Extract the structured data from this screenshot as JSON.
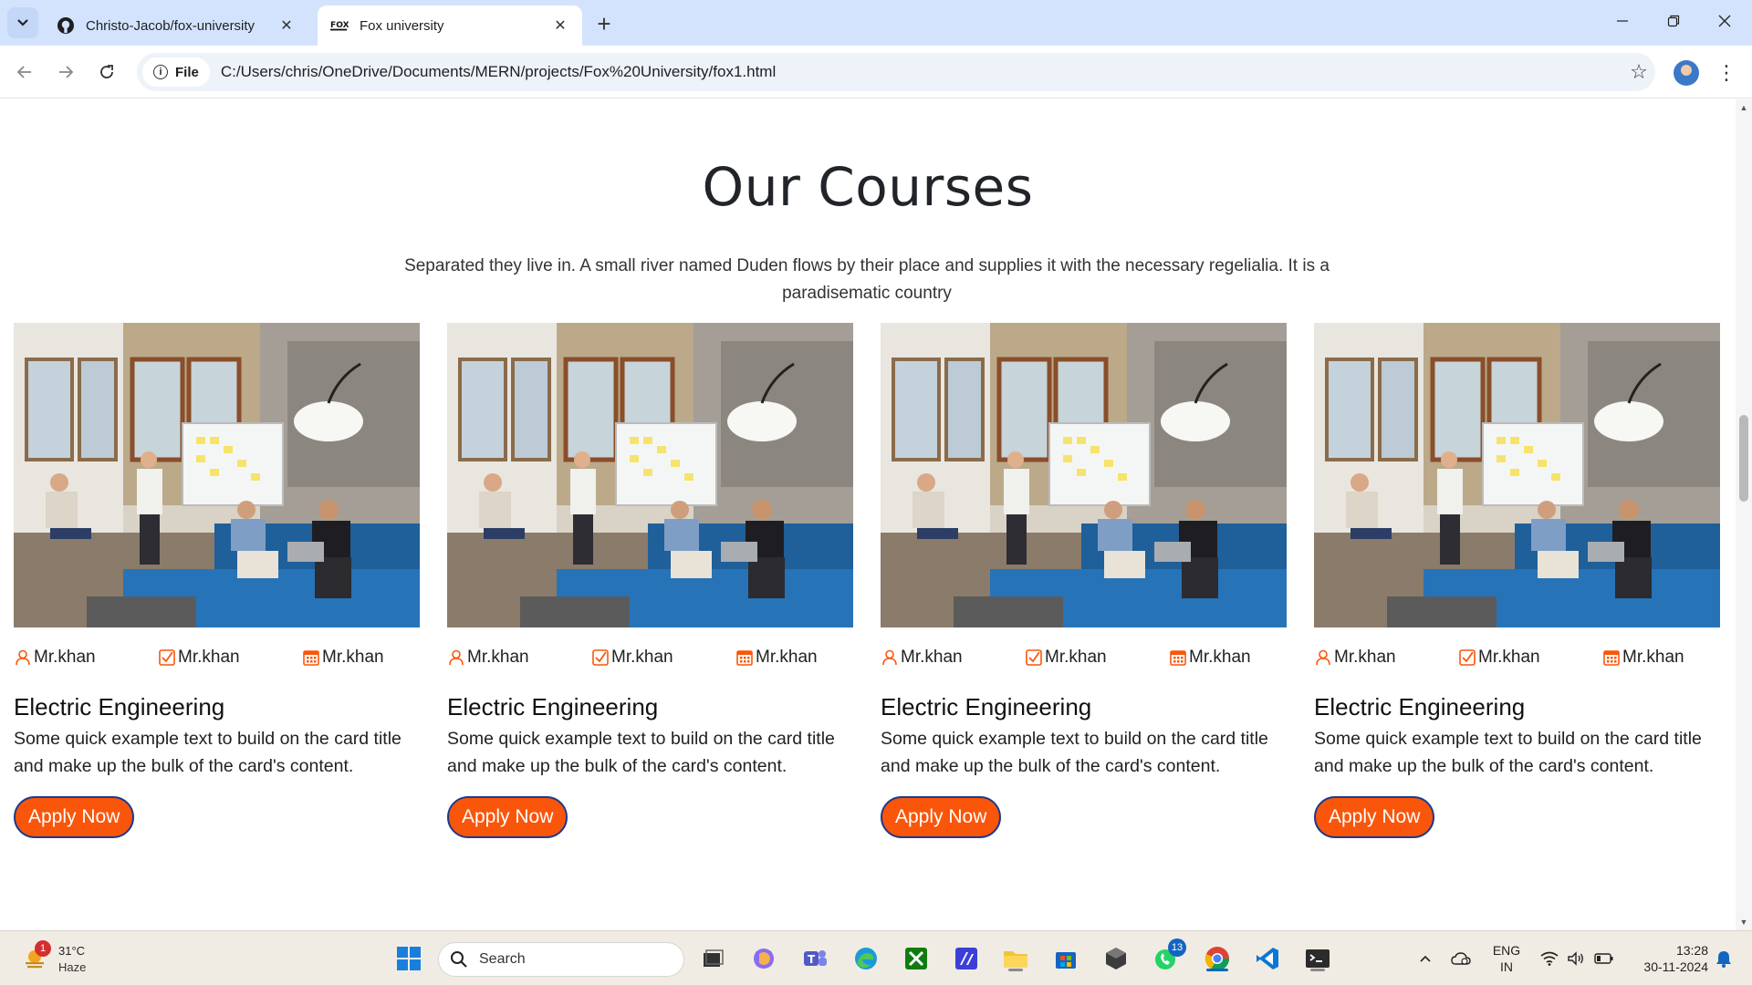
{
  "browser": {
    "tabs": [
      {
        "title": "Christo-Jacob/fox-university",
        "favicon": "github-icon",
        "active": false
      },
      {
        "title": "Fox university",
        "favicon": "fox-logo-icon",
        "active": true
      }
    ],
    "omnibox": {
      "scheme_label": "File",
      "url": "C:/Users/chris/OneDrive/Documents/MERN/projects/Fox%20University/fox1.html"
    }
  },
  "page": {
    "section_title": "Our Courses",
    "section_subtitle": "Separated they live in. A small river named Duden flows by their place and supplies it with the necessary regelialia. It is a paradisematic country",
    "cards": [
      {
        "meta": [
          "Mr.khan",
          "Mr.khan",
          "Mr.khan"
        ],
        "title": "Electric Engineering",
        "text": "Some quick example text to build on the card title and make up the bulk of the card's content.",
        "button": "Apply Now"
      },
      {
        "meta": [
          "Mr.khan",
          "Mr.khan",
          "Mr.khan"
        ],
        "title": "Electric Engineering",
        "text": "Some quick example text to build on the card title and make up the bulk of the card's content.",
        "button": "Apply Now"
      },
      {
        "meta": [
          "Mr.khan",
          "Mr.khan",
          "Mr.khan"
        ],
        "title": "Electric Engineering",
        "text": "Some quick example text to build on the card title and make up the bulk of the card's content.",
        "button": "Apply Now"
      },
      {
        "meta": [
          "Mr.khan",
          "Mr.khan",
          "Mr.khan"
        ],
        "title": "Electric Engineering",
        "text": "Some quick example text to build on the card title and make up the bulk of the card's content.",
        "button": "Apply Now"
      }
    ],
    "meta_icons": [
      "user-icon",
      "checkbox-icon",
      "calendar-icon"
    ],
    "accent_color": "#f9560b"
  },
  "taskbar": {
    "weather": {
      "temp": "31°C",
      "condition": "Haze",
      "badge": "1"
    },
    "search_placeholder": "Search",
    "whatsapp_badge": "13",
    "language": {
      "line1": "ENG",
      "line2": "IN"
    },
    "clock": {
      "time": "13:28",
      "date": "30-11-2024"
    }
  }
}
